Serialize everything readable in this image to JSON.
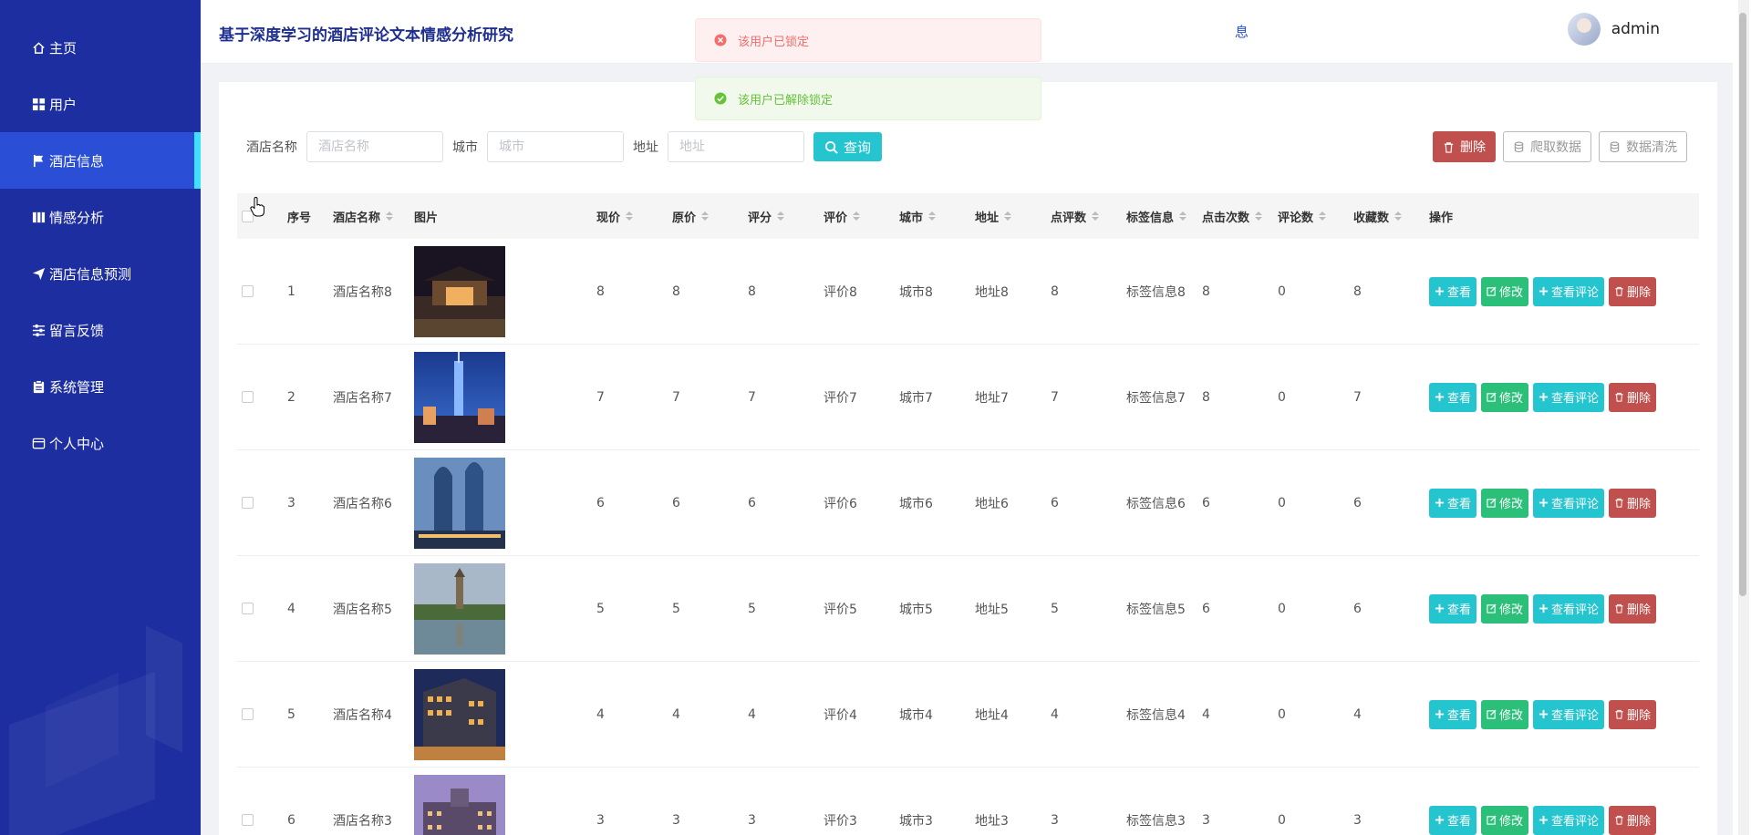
{
  "app": {
    "title": "基于深度学习的酒店评论文本情感分析研究",
    "header_fragment": "息"
  },
  "user": {
    "name": "admin"
  },
  "sidebar": {
    "items": [
      {
        "label": "主页",
        "icon": "home-icon",
        "active": false
      },
      {
        "label": "用户",
        "icon": "grid-icon",
        "active": false
      },
      {
        "label": "酒店信息",
        "icon": "flag-icon",
        "active": true
      },
      {
        "label": "情感分析",
        "icon": "book-icon",
        "active": false
      },
      {
        "label": "酒店信息预测",
        "icon": "send-icon",
        "active": false
      },
      {
        "label": "留言反馈",
        "icon": "sliders-icon",
        "active": false
      },
      {
        "label": "系统管理",
        "icon": "clipboard-icon",
        "active": false
      },
      {
        "label": "个人中心",
        "icon": "wallet-icon",
        "active": false
      }
    ]
  },
  "toasts": {
    "error": "该用户已锁定",
    "success": "该用户已解除锁定"
  },
  "search": {
    "hotel_label": "酒店名称",
    "hotel_placeholder": "酒店名称",
    "city_label": "城市",
    "city_placeholder": "城市",
    "address_label": "地址",
    "address_placeholder": "地址",
    "query_label": "查询"
  },
  "toolbar": {
    "delete_label": "删除",
    "crawl_label": "爬取数据",
    "clean_label": "数据清洗"
  },
  "table": {
    "headers": [
      "序号",
      "酒店名称",
      "图片",
      "现价",
      "原价",
      "评分",
      "评价",
      "城市",
      "地址",
      "点评数",
      "标签信息",
      "点击次数",
      "评论数",
      "收藏数",
      "操作"
    ],
    "op_labels": {
      "view": "查看",
      "edit": "修改",
      "comment": "查看评论",
      "delete": "删除"
    },
    "rows": [
      {
        "idx": "1",
        "name": "酒店名称8",
        "price": "8",
        "orig": "8",
        "score": "8",
        "review": "评价8",
        "city": "城市8",
        "addr": "地址8",
        "cmts": "8",
        "tag": "标签信息8",
        "clicks": "8",
        "comments": "0",
        "favs": "8"
      },
      {
        "idx": "2",
        "name": "酒店名称7",
        "price": "7",
        "orig": "7",
        "score": "7",
        "review": "评价7",
        "city": "城市7",
        "addr": "地址7",
        "cmts": "7",
        "tag": "标签信息7",
        "clicks": "8",
        "comments": "0",
        "favs": "7"
      },
      {
        "idx": "3",
        "name": "酒店名称6",
        "price": "6",
        "orig": "6",
        "score": "6",
        "review": "评价6",
        "city": "城市6",
        "addr": "地址6",
        "cmts": "6",
        "tag": "标签信息6",
        "clicks": "6",
        "comments": "0",
        "favs": "6"
      },
      {
        "idx": "4",
        "name": "酒店名称5",
        "price": "5",
        "orig": "5",
        "score": "5",
        "review": "评价5",
        "city": "城市5",
        "addr": "地址5",
        "cmts": "5",
        "tag": "标签信息5",
        "clicks": "6",
        "comments": "0",
        "favs": "6"
      },
      {
        "idx": "5",
        "name": "酒店名称4",
        "price": "4",
        "orig": "4",
        "score": "4",
        "review": "评价4",
        "city": "城市4",
        "addr": "地址4",
        "cmts": "4",
        "tag": "标签信息4",
        "clicks": "4",
        "comments": "0",
        "favs": "4"
      },
      {
        "idx": "6",
        "name": "酒店名称3",
        "price": "3",
        "orig": "3",
        "score": "3",
        "review": "评价3",
        "city": "城市3",
        "addr": "地址3",
        "cmts": "3",
        "tag": "标签信息3",
        "clicks": "3",
        "comments": "0",
        "favs": "3"
      }
    ]
  },
  "colors": {
    "sidebar": "#1d2ea0",
    "active": "#2a4fd6",
    "accent": "#25c5cf",
    "danger": "#c0504d",
    "success": "#2bbf7a"
  }
}
